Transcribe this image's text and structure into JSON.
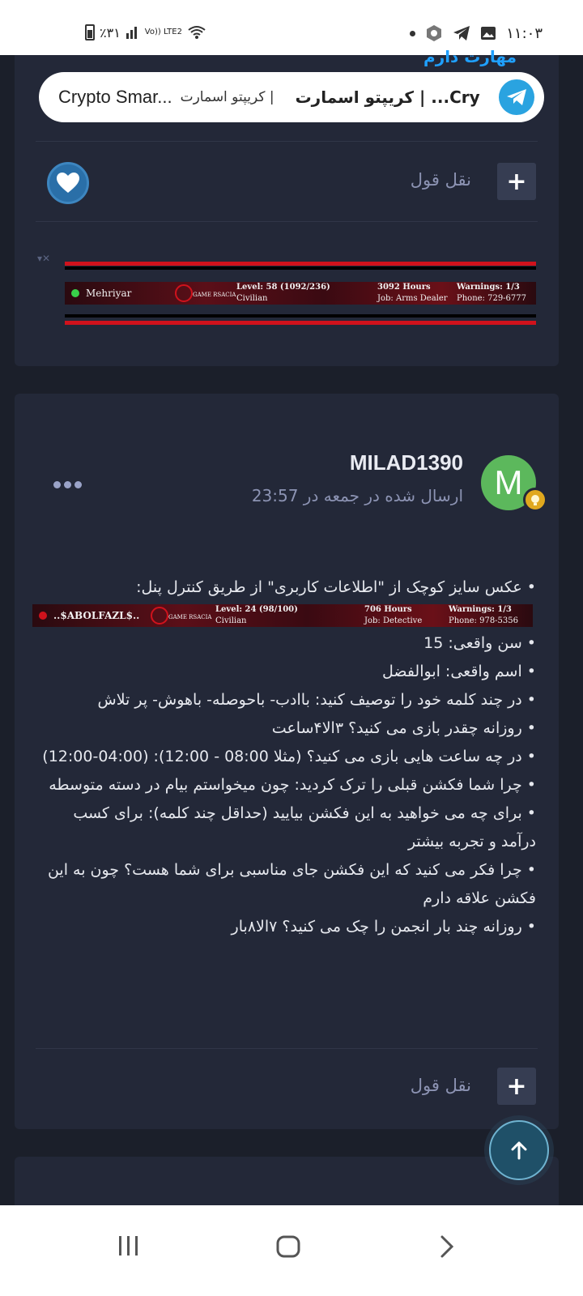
{
  "status": {
    "time": "۱۱:۰۳",
    "battery": "٪۳۱",
    "network": "Vo)) LTE2"
  },
  "top_bar": {
    "peek_text": "مهارت دارم",
    "link_text_left": "Crypto Smar...",
    "link_text_mid": "کریپتو اسمارت |",
    "link_text_bold": "کریپتو اسمارت | ...Cry"
  },
  "post1": {
    "quote_label": "نقل قول",
    "signature": {
      "name": "Mehriyar",
      "logo": "GAME RSACIA",
      "level": "Level: 58 (1092/236)",
      "rank": "Civilian",
      "hours": "3092 Hours",
      "job": "Job: Arms Dealer",
      "warnings": "Warnings: 1/3",
      "phone": "Phone: 729-6777"
    }
  },
  "post2": {
    "avatar_letter": "M",
    "author": "MILAD1390",
    "posted": "ارسال شده در جمعه در 23:57",
    "quote_label": "نقل قول",
    "signature": {
      "name": "..$ABOLFAZL$..",
      "logo": "GAME RSACIA",
      "level": "Level: 24 (98/100)",
      "rank": "Civilian",
      "hours": "706 Hours",
      "job": "Job: Detective",
      "warnings": "Warnings: 1/3",
      "phone": "Phone: 978-5356"
    },
    "lines": [
      "• عکس سایز کوچک از \"اطلاعات کاربری\" از طریق کنترل پنل:",
      "• سن واقعی: 15",
      "• اسم واقعی: ابوالفضل",
      "• در چند کلمه خود را توصیف کنید: باادب- باحوصله- باهوش- پر تلاش",
      "• روزانه چقدر بازی می کنید؟ ۳الا۴ساعت",
      "• در چه ساعت هایی بازی می کنید؟ (مثلا 08:00 - 12:00): (04:00-12:00)",
      "• چرا شما فکشن قبلی را ترک کردید: چون میخواستم بیام در دسته متوسطه",
      "• برای چه می خواهید به این فکشن بیایید (حداقل چند کلمه): برای کسب درآمد و تجربه بیشتر",
      "• چرا فکر می کنید که این فکشن جای مناسبی برای شما هست؟ چون به این فکشن علاقه دارم",
      "• روزانه چند بار انجمن را چک می کنید؟ ۷الا۸بار"
    ]
  },
  "colors": {
    "background": "#1b1f2a",
    "card": "#232838",
    "muted": "#8c93b3",
    "avatar": "#5cb85c",
    "telegram": "#2aa3e0",
    "signature_red": "#d0121c"
  },
  "icons": [
    "battery-icon",
    "signal-icon",
    "wifi-icon",
    "dot-icon",
    "app-icon",
    "telegram-icon",
    "gallery-icon",
    "heart-icon",
    "plus-icon",
    "more-icon",
    "arrow-up-icon",
    "recents-icon",
    "home-icon",
    "back-icon"
  ]
}
